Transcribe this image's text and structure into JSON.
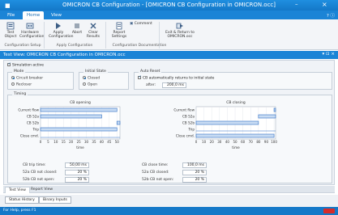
{
  "window": {
    "title": "OMICRON CB Configuration - [OMICRON CB Configuration in OMICRON.occ]",
    "minimize": "–",
    "close": "×"
  },
  "ribbon": {
    "tabs": [
      "File",
      "Home",
      "View"
    ],
    "active_tab": "Home",
    "buttons": {
      "test_object": "Test Object",
      "hardware_configuration": "Hardware Configuration",
      "apply_configuration": "Apply Configuration",
      "abort": "Abort",
      "clear_results": "Clear Results",
      "report_settings": "Report Settings",
      "comment": "Comment",
      "exit_return": "Exit & Return to OMICRON.occ"
    },
    "groups": {
      "configuration_setup": "Configuration Setup",
      "apply_configuration": "Apply Configuration",
      "configuration_documentation": "Configuration Documentation"
    }
  },
  "document": {
    "title": "Test View: OMICRON CB Configuration in OMICRON.occ"
  },
  "main": {
    "simulation_active": {
      "label": "Simulation active",
      "checked": true
    },
    "mode": {
      "label": "Mode",
      "options": [
        "Circuit breaker",
        "Recloser"
      ],
      "selected": "Circuit breaker"
    },
    "initial_state": {
      "label": "Initial State",
      "options": [
        "Closed",
        "Open"
      ],
      "selected": "Closed"
    },
    "auto_reset": {
      "label": "Auto Reset",
      "checkbox_label": "CB automatically returns to initial state",
      "checked": true,
      "after_label": "after:",
      "after_value": "200,0 ms"
    },
    "timing": {
      "label": "Timing",
      "fields_left": [
        {
          "label": "CB trip time:",
          "value": "50,00 ms"
        },
        {
          "label": "52a CB not closed:",
          "value": "20 %"
        },
        {
          "label": "52b CB not open:",
          "value": "20 %"
        }
      ],
      "fields_right": [
        {
          "label": "CB close time:",
          "value": "100,0 ms"
        },
        {
          "label": "52a CB closed:",
          "value": "20 %"
        },
        {
          "label": "52b CB not open:",
          "value": "20 %"
        }
      ]
    }
  },
  "chart_data": [
    {
      "type": "bar",
      "title": "CB opening",
      "xlabel": "time",
      "categories": [
        "Current flow",
        "CB 52a",
        "CB 52b",
        "Trip",
        "Close cmd."
      ],
      "x_ticks": [
        0,
        5,
        10,
        15,
        20,
        25,
        30,
        35,
        40,
        45,
        50
      ],
      "xlim": [
        0,
        52
      ],
      "spans": [
        {
          "category": "Current flow",
          "start": 0,
          "end": 50
        },
        {
          "category": "CB 52a",
          "start": 0,
          "end": 40
        },
        {
          "category": "CB 52b",
          "start": 50,
          "end": 52
        },
        {
          "category": "Trip",
          "start": 0,
          "end": 50
        },
        {
          "category": "Close cmd.",
          "start": 0,
          "end": 0
        }
      ]
    },
    {
      "type": "bar",
      "title": "CB closing",
      "xlabel": "time",
      "categories": [
        "Current flow",
        "CB 52a",
        "CB 52b",
        "Trip",
        "Close cmd."
      ],
      "x_ticks": [
        0,
        10,
        20,
        30,
        40,
        50,
        60,
        70,
        80,
        90,
        100
      ],
      "xlim": [
        0,
        102
      ],
      "spans": [
        {
          "category": "Current flow",
          "start": 100,
          "end": 102
        },
        {
          "category": "CB 52a",
          "start": 80,
          "end": 102
        },
        {
          "category": "CB 52b",
          "start": 0,
          "end": 80
        },
        {
          "category": "Trip",
          "start": 0,
          "end": 0
        },
        {
          "category": "Close cmd.",
          "start": 0,
          "end": 100
        }
      ]
    }
  ],
  "view_tabs": [
    "Test View",
    "Report View"
  ],
  "active_view_tab": "Test View",
  "bottom_buttons": [
    "Status History",
    "Binary Inputs"
  ],
  "status": {
    "text": "For Help, press F1"
  },
  "colors": {
    "accent": "#1b84d6",
    "bar_fill": "#c9dcf3",
    "bar_stroke": "#2b6cc4"
  }
}
